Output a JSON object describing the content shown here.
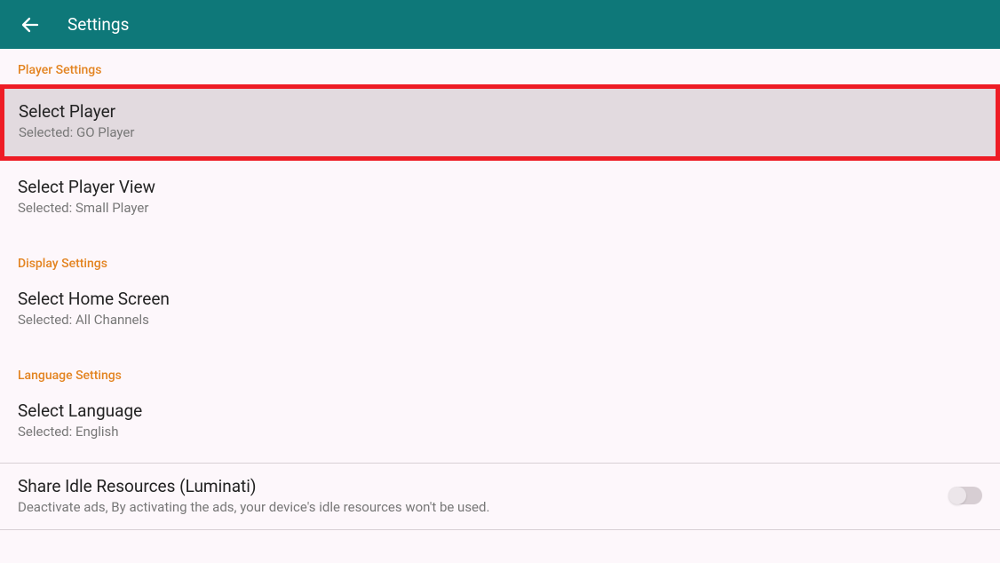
{
  "appbar": {
    "title": "Settings"
  },
  "sections": {
    "player": {
      "header": "Player Settings",
      "select_player": {
        "title": "Select Player",
        "subtitle": "Selected: GO Player"
      },
      "select_player_view": {
        "title": "Select Player View",
        "subtitle": "Selected: Small Player"
      }
    },
    "display": {
      "header": "Display Settings",
      "select_home": {
        "title": "Select Home Screen",
        "subtitle": "Selected: All Channels"
      }
    },
    "language": {
      "header": "Language Settings",
      "select_lang": {
        "title": "Select Language",
        "subtitle": "Selected: English"
      }
    },
    "share_idle": {
      "title": "Share Idle Resources (Luminati)",
      "subtitle": "Deactivate ads, By activating the ads, your device's idle resources won't be used.",
      "enabled": false
    }
  }
}
